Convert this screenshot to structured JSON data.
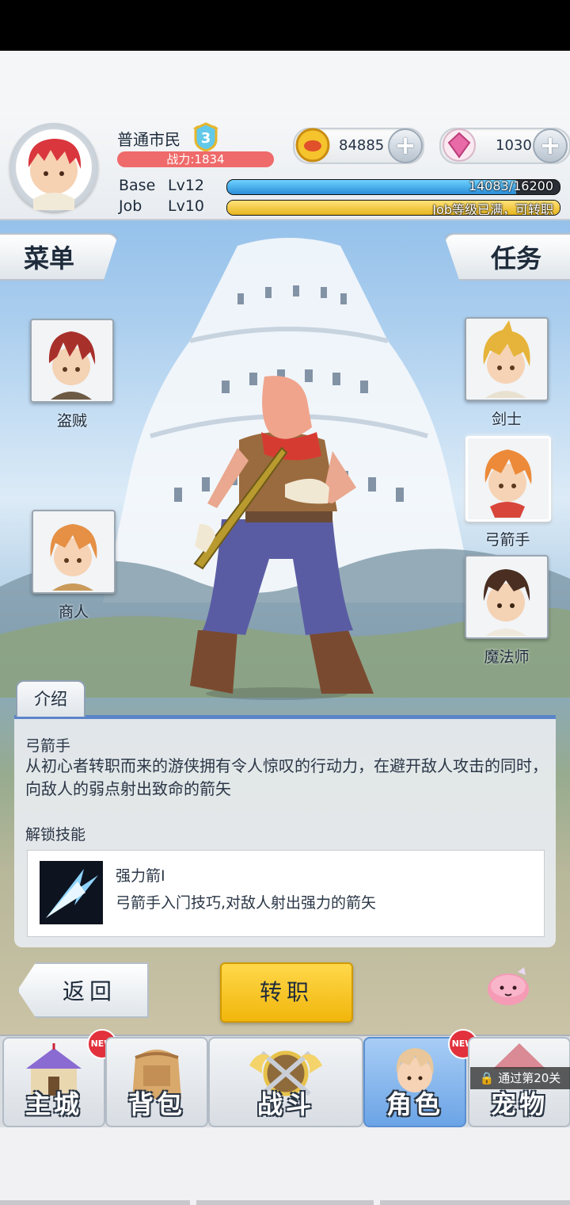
{
  "header": {
    "player_title": "普通市民",
    "rank_badge": "3",
    "combat_power": "战力:1834",
    "gold": "84885",
    "gems": "1030",
    "base_label": "Base",
    "base_level": "Lv12",
    "base_exp": "14083/16200",
    "base_progress": 0.869,
    "job_label": "Job",
    "job_level": "Lv10",
    "job_status": "Job等级已满，可转职",
    "job_progress": 1.0
  },
  "side_tabs": {
    "menu": "菜单",
    "tasks": "任务"
  },
  "jobs": {
    "thief": "盗贼",
    "merchant": "商人",
    "swordsman": "剑士",
    "archer": "弓箭手",
    "mage": "魔法师"
  },
  "info": {
    "tab": "介绍",
    "job_title": "弓箭手",
    "job_desc": "从初心者转职而来的游侠拥有令人惊叹的行动力，在避开敌人攻击的同时，向敌人的弱点射出致命的箭矢",
    "unlock_label": "解锁技能",
    "skill_name": "强力箭Ⅰ",
    "skill_desc": "弓箭手入门技巧,对敌人射出强力的箭矢"
  },
  "buttons": {
    "back": "返回",
    "change_job": "转职"
  },
  "nav": {
    "main_city": "主城",
    "bag": "背包",
    "battle": "战斗",
    "character": "角色",
    "pet": "宠物",
    "new_badge": "NEW",
    "pet_lock": "通过第20关"
  },
  "colors": {
    "accent_blue": "#5b84c9",
    "gold_button": "#ffd84a",
    "power_bar": "#ef6a6a",
    "base_bar": "#2a8ed8",
    "job_bar": "#e7b51e"
  }
}
